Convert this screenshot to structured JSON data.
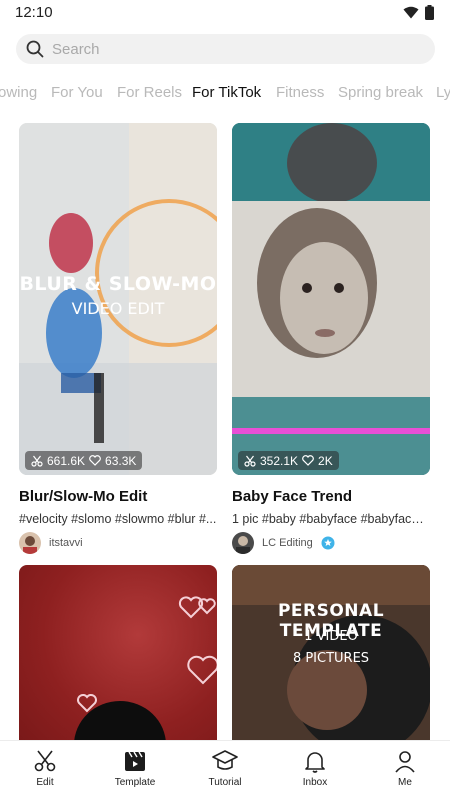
{
  "status_bar": {
    "time": "12:10",
    "icons": [
      "wifi-icon",
      "battery-icon"
    ]
  },
  "search": {
    "placeholder": "Search"
  },
  "tabs": [
    {
      "label": "owing",
      "active": false
    },
    {
      "label": "For You",
      "active": false
    },
    {
      "label": "For Reels",
      "active": false
    },
    {
      "label": "For TikTok",
      "active": true
    },
    {
      "label": "Fitness",
      "active": false
    },
    {
      "label": "Spring break",
      "active": false
    },
    {
      "label": "Ly",
      "active": false
    }
  ],
  "cards": [
    {
      "title": "Blur/Slow-Mo Edit",
      "tags": "#velocity #slomo #slowmo #blur #...",
      "author": "itstavvi",
      "uses": "661.6K",
      "likes": "63.3K",
      "overlay_line1": "BLUR & SLOW-MO",
      "overlay_line2": "VIDEO EDIT"
    },
    {
      "title": "Baby Face Trend",
      "tags": "1 pic #baby #babyface #babyfacetr...",
      "author": "LC Editing",
      "uses": "352.1K",
      "likes": "2K"
    },
    {
      "title": "",
      "tags": "",
      "author": ""
    },
    {
      "overlay_line1": "PERSONAL TEMPLATE",
      "overlay_line2": "1 VIDEO",
      "overlay_line3": "8 PICTURES"
    }
  ],
  "bottom_nav": [
    {
      "label": "Edit",
      "icon": "scissors-icon"
    },
    {
      "label": "Template",
      "icon": "template-icon",
      "active": true
    },
    {
      "label": "Tutorial",
      "icon": "graduation-cap-icon"
    },
    {
      "label": "Inbox",
      "icon": "bell-icon"
    },
    {
      "label": "Me",
      "icon": "person-icon"
    }
  ],
  "colors": {
    "accent": "#1c1c1c",
    "verified": "#3fb3e8",
    "tab_inactive": "#b9b9b9"
  }
}
